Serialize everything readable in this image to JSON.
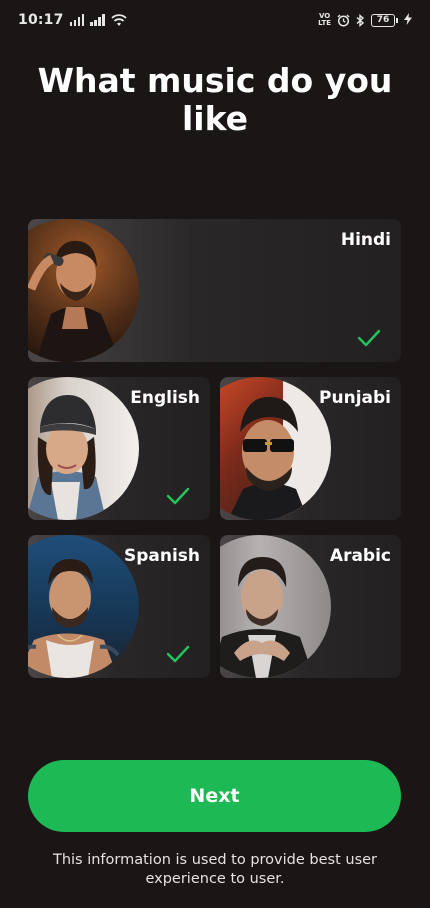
{
  "status_bar": {
    "time": "10:17",
    "volte_label_1": "VO",
    "volte_label_2": "LTE",
    "battery": "76"
  },
  "title": "What music do you like",
  "languages": [
    {
      "label": "Hindi",
      "selected": true
    },
    {
      "label": "English",
      "selected": true
    },
    {
      "label": "Punjabi",
      "selected": false
    },
    {
      "label": "Spanish",
      "selected": true
    },
    {
      "label": "Arabic",
      "selected": false
    }
  ],
  "next_button_label": "Next",
  "footnote": "This information is used to provide best user experience to user.",
  "colors": {
    "background": "#1b1616",
    "accent": "#1db954",
    "check": "#22c55e"
  }
}
